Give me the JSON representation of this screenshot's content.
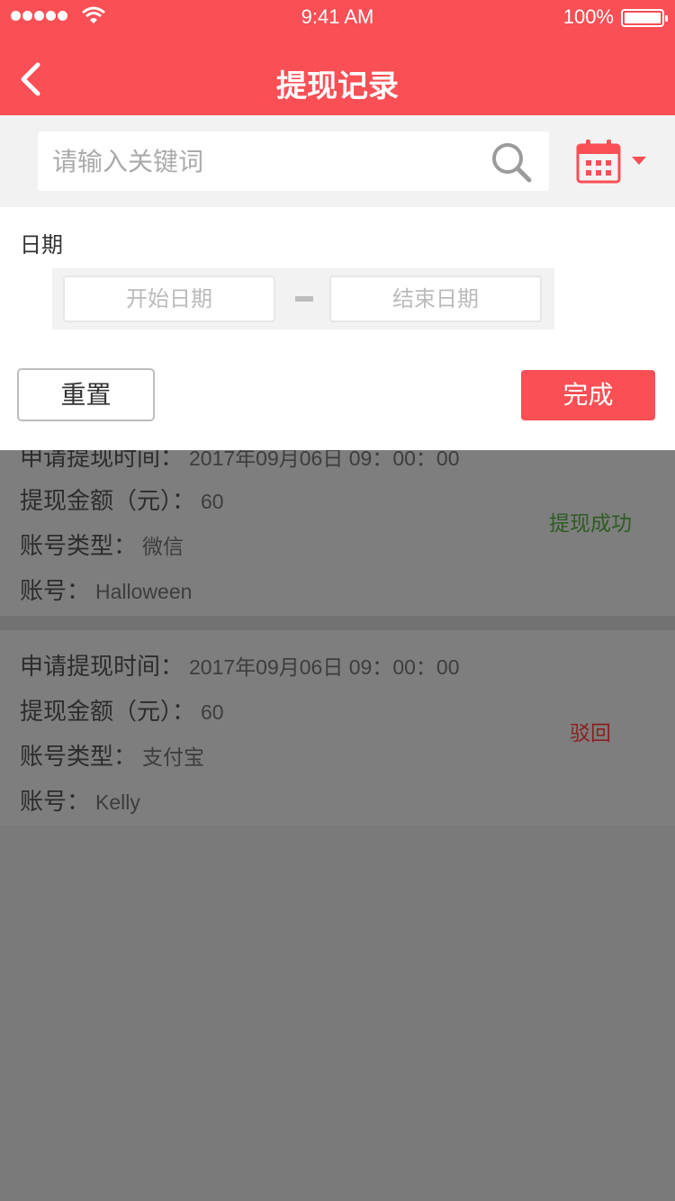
{
  "statusbar": {
    "time": "9:41 AM",
    "battery": "100%"
  },
  "header": {
    "title": "提现记录"
  },
  "search": {
    "placeholder": "请输入关键词"
  },
  "filter": {
    "date_label": "日期",
    "start_placeholder": "开始日期",
    "end_placeholder": "结束日期",
    "reset_label": "重置",
    "done_label": "完成"
  },
  "labels": {
    "apply_time": "申请提现时间：",
    "amount": "提现金额（元）：",
    "account_type": "账号类型：",
    "account": "账号："
  },
  "records": [
    {
      "apply_time": "2017年09月06日  09：00：00",
      "amount": "60",
      "account_type": "微信",
      "account": "Halloween",
      "status": "提现成功"
    },
    {
      "apply_time": "2017年09月06日  09：00：00",
      "amount": "60",
      "account_type": "支付宝",
      "account": "Kelly",
      "status": "驳回"
    }
  ],
  "colors": {
    "brand": "#f94f55",
    "success": "#2e5c22",
    "reject": "#8c1f1f"
  }
}
